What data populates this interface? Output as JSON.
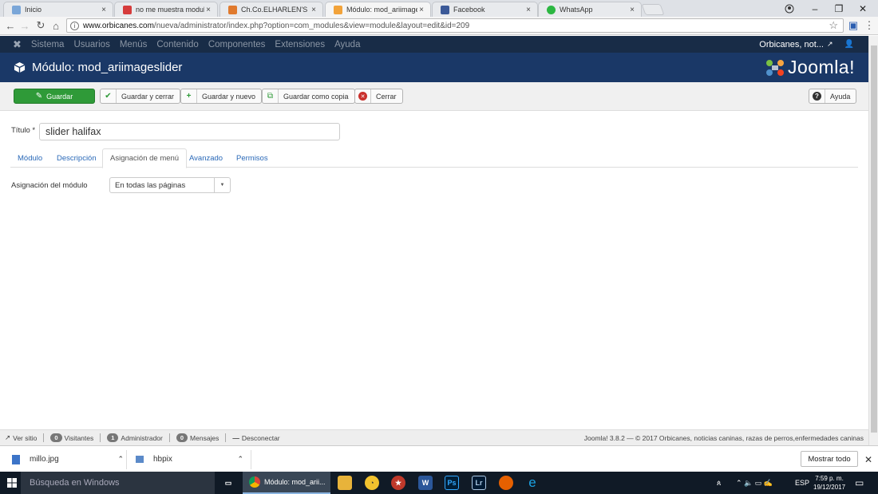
{
  "browser": {
    "tabs": [
      {
        "title": "Inicio",
        "color": "#7aa6d8"
      },
      {
        "title": "no me muestra modulos",
        "color": "#d63c3c"
      },
      {
        "title": "Ch.Co.ELHARLEN'S HALI",
        "color": "#e07a2e"
      },
      {
        "title": "Módulo: mod_ariimages",
        "color": "#f2a33a"
      },
      {
        "title": "Facebook",
        "color": "#3b5998"
      },
      {
        "title": "WhatsApp",
        "color": "#2cb742"
      }
    ],
    "close_glyph": "×",
    "url_host": "www.orbicanes.com",
    "url_path": "/nueva/administrator/index.php?option=com_modules&view=module&layout=edit&id=209"
  },
  "joomla": {
    "top_menu": [
      "Sistema",
      "Usuarios",
      "Menús",
      "Contenido",
      "Componentes",
      "Extensiones",
      "Ayuda"
    ],
    "user_label": "Orbicanes, not...",
    "page_title": "Módulo: mod_ariimageslider",
    "logo_text": "Joomla!",
    "toolbar": {
      "save": "Guardar",
      "save_close": "Guardar y cerrar",
      "save_new": "Guardar y nuevo",
      "save_copy": "Guardar como copia",
      "close": "Cerrar",
      "help": "Ayuda"
    },
    "title_label": "Título *",
    "title_value": "slider halifax",
    "tabs": [
      "Módulo",
      "Descripción",
      "Asignación de menú",
      "Avanzado",
      "Permisos"
    ],
    "assignment_label": "Asignación del módulo",
    "assignment_value": "En todas las páginas",
    "status": {
      "view_site": "Ver sitio",
      "visitors_count": "0",
      "visitors": "Visitantes",
      "admins_count": "1",
      "admins": "Administrador",
      "messages_count": "0",
      "messages": "Mensajes",
      "logout": "Desconectar",
      "footer": "Joomla! 3.8.2 — © 2017 Orbicanes, noticias caninas, razas de perros,enfermedades caninas"
    },
    "colors": {
      "navbar": "#182c47",
      "header": "#1a3867",
      "save_green": "#2f9a38"
    }
  },
  "downloads": {
    "items": [
      "millo.jpg",
      "hbpix"
    ],
    "show_all": "Mostrar todo"
  },
  "taskbar": {
    "search_placeholder": "Búsqueda en Windows",
    "active_app": "Módulo: mod_arii...",
    "language": "ESP",
    "time": "7:59 p. m.",
    "date": "19/12/2017"
  }
}
